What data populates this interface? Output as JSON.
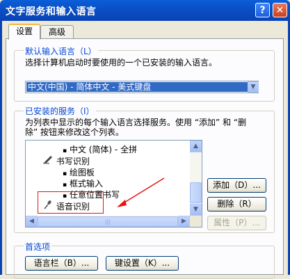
{
  "window": {
    "title": "文字服务和输入语言",
    "help_glyph": "?",
    "close_glyph": "✕"
  },
  "tabs": [
    {
      "label": "设置",
      "active": true
    },
    {
      "label": "高级",
      "active": false
    }
  ],
  "default_language": {
    "group_label": "默认输入语言（L）",
    "description": "选择计算机启动时要使用的一个已安装的输入语言。",
    "selected_value": "中文(中国) - 简体中文 - 美式键盘"
  },
  "installed_services": {
    "group_label": "已安装的服务（I）",
    "description_line1": "为列表中显示的每个输入语言选择服务。使用 “添加” 和 “删",
    "description_line2": "除” 按钮来修改这个列表。",
    "items": [
      {
        "label": "中文 (简体) - 全拼",
        "bullet": "▪"
      },
      {
        "label": "书写识别"
      },
      {
        "label": "绘图板",
        "bullet": "▪"
      },
      {
        "label": "框式输入",
        "bullet": "▪"
      },
      {
        "label": "任意位置书写",
        "bullet": "▪"
      },
      {
        "label": "语音识别"
      }
    ],
    "add_label": "添加（D）...",
    "remove_label": "删除（R）",
    "properties_label": "属性（P）..."
  },
  "preferences": {
    "group_label": "首选项",
    "language_bar_label": "语言栏（B）...",
    "key_settings_label": "键设置（K）..."
  },
  "colors": {
    "annotation": "#e8120c",
    "title_bar": "#0b4ec4",
    "selection": "#316ac5"
  }
}
